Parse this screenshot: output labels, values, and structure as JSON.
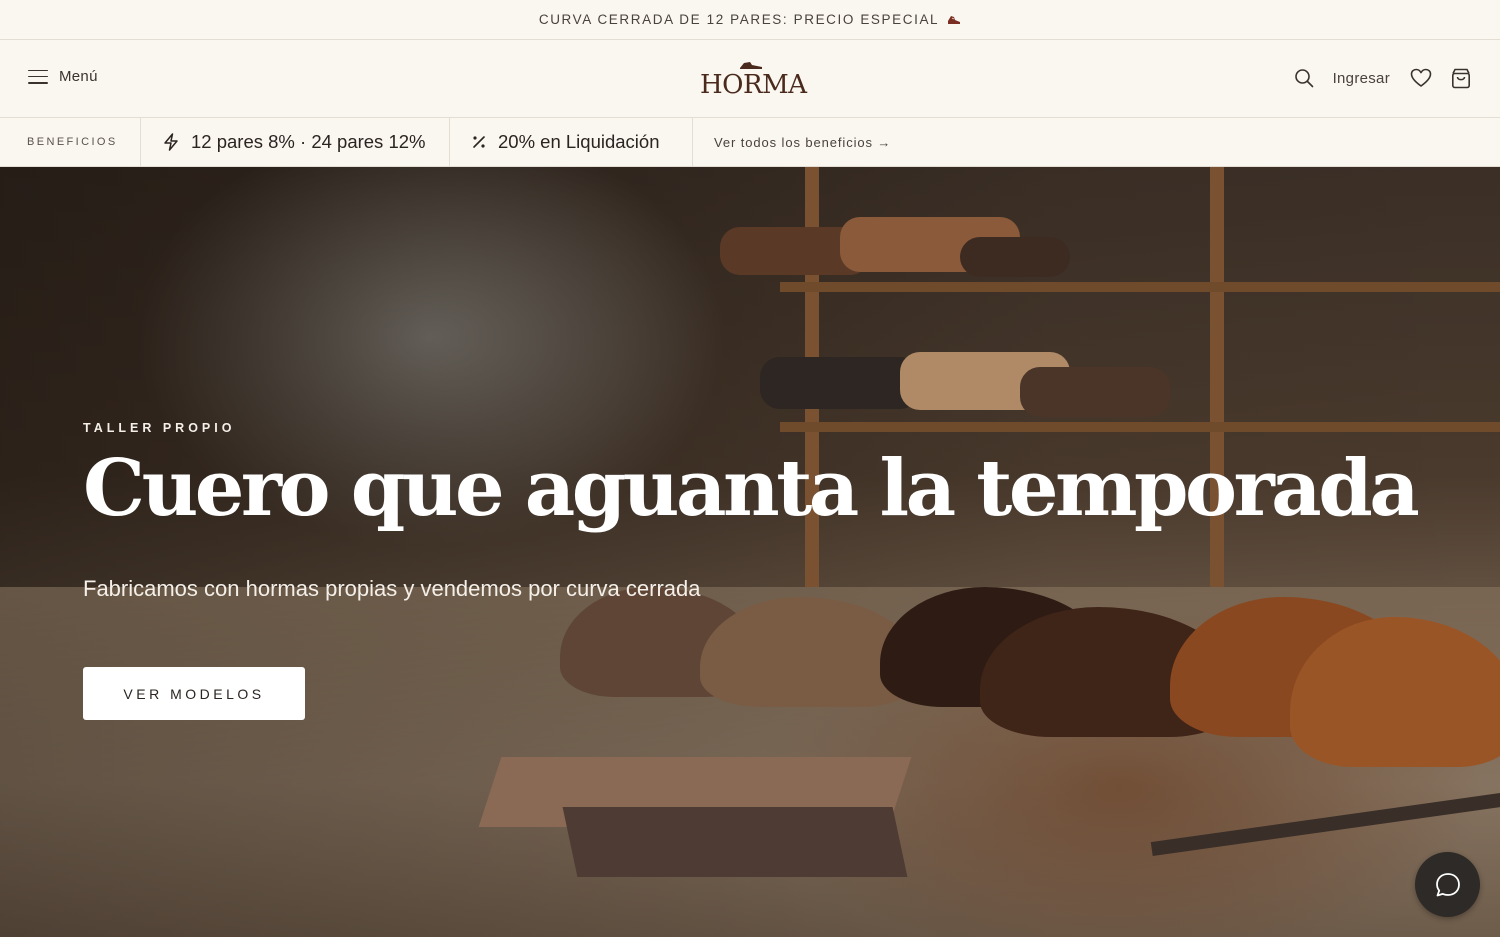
{
  "announcement": {
    "text": "CURVA CERRADA DE 12 PARES: PRECIO ESPECIAL",
    "icon": "shoe-icon"
  },
  "header": {
    "menu_label": "Menú",
    "logo_text": "HORMA",
    "login_label": "Ingresar",
    "icons": [
      "hamburger-icon",
      "search-icon",
      "heart-icon",
      "shopping-bag-icon"
    ]
  },
  "benefits": {
    "label": "BENEFICIOS",
    "items": [
      {
        "icon": "lightning-icon",
        "text": "12 pares 8% · 24 pares 12%"
      },
      {
        "icon": "percent-icon",
        "text": "20% en Liquidación"
      }
    ],
    "see_all": "Ver todos los beneficios →"
  },
  "hero": {
    "eyebrow": "TALLER PROPIO",
    "title": "Cuero que aguanta la temporada",
    "subtitle": "Fabricamos con hormas propias y vendemos por curva cerrada",
    "cta": "VER MODELOS"
  },
  "chat": {
    "icon": "chat-bubble-icon"
  },
  "colors": {
    "background": "#faf7f1",
    "logo": "#4a2a1c",
    "chat_button": "#2d2a27"
  }
}
